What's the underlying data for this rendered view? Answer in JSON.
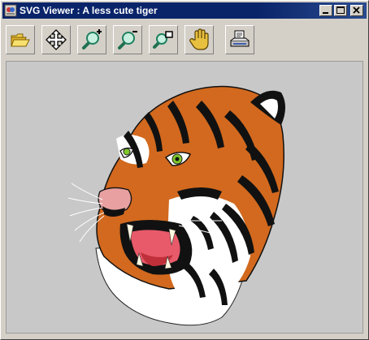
{
  "window": {
    "title": "SVG Viewer : A less cute tiger",
    "controls": [
      "minimize-icon",
      "maximize-icon",
      "close-icon"
    ]
  },
  "toolbar": {
    "buttons": [
      {
        "name": "open-button",
        "icon": "folder-open-icon"
      },
      {
        "name": "pan-button",
        "icon": "move-arrows-icon"
      },
      {
        "name": "zoom-in-button",
        "icon": "zoom-in-icon"
      },
      {
        "name": "zoom-out-button",
        "icon": "zoom-out-icon"
      },
      {
        "name": "zoom-fit-button",
        "icon": "zoom-fit-icon"
      },
      {
        "name": "grab-button",
        "icon": "hand-icon"
      },
      {
        "name": "print-button",
        "icon": "printer-icon"
      }
    ]
  },
  "colors": {
    "titlebar": "#0a246a",
    "face": "#d4d0c8",
    "canvas_bg": "#c8c8c8",
    "tiger_orange": "#d2691e",
    "tiger_eye": "#7ec82a"
  },
  "canvas": {
    "image": "tiger-image"
  }
}
